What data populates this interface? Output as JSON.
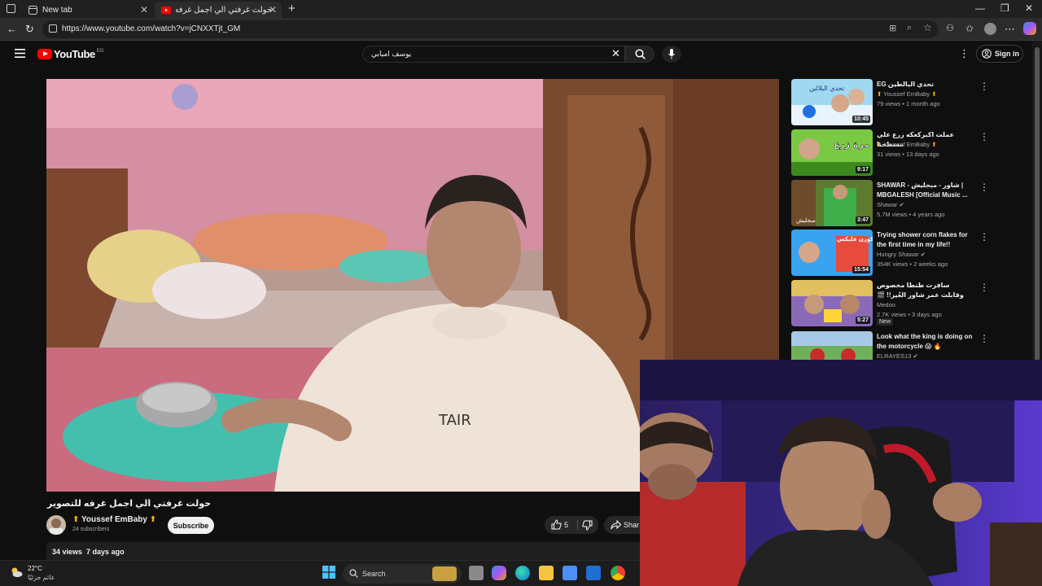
{
  "browser": {
    "tabs": [
      {
        "label": "New tab"
      },
      {
        "label": "حولت غرفتي الي اجمل غرفه للتصو"
      }
    ],
    "url": "https://www.youtube.com/watch?v=jCNXXTjt_GM"
  },
  "youtube": {
    "logo_text": "YouTube",
    "country_code": "EG",
    "search_query": "يوسف امبابي",
    "signin_label": "Sign in"
  },
  "video": {
    "title": "حولت غرفتي الي اجمل غرفه للتصوير",
    "channel": "Youssef EmBaby",
    "subscribers": "24 subscribers",
    "subscribe_label": "Subscribe",
    "likes": "5",
    "share_label": "Shar",
    "views": "34 views",
    "date": "7 days ago",
    "overlay_text": "TAIR"
  },
  "recommendations": [
    {
      "title": "تحدي البالطين EG",
      "channel": "Youssef EmBaby",
      "meta": "79 views • 1 month ago",
      "duration": "10:45",
      "thumb_text": "تحدي البلالين"
    },
    {
      "title": "عملت اكبركعكه زرع علي مسطحنا",
      "channel": "Youssef EmBaby",
      "meta": "31 views • 13 days ago",
      "duration": "9:17",
      "thumb_text": "تول مرة زرع"
    },
    {
      "title": "SHAWAR - شاور - مبجلیش | MBGALESH [Official Music ...",
      "channel": "Shawar",
      "meta": "5.7M views • 4 years ago",
      "duration": "3:47",
      "thumb_text": "مبجليش"
    },
    {
      "title": "Trying shower corn flakes for the first time in my life!!",
      "channel": "Hungry Shawar",
      "meta": "354K views • 2 weeks ago",
      "duration": "15:54",
      "thumb_text": "كورن فليكس"
    },
    {
      "title": "سافرت طنطا مخصوص وقابلت عمر شاور العُيز!! 🎬 (ما كنتش متخيل اللي حصل)",
      "channel": "Medoo",
      "meta": "2.7K views • 3 days ago",
      "duration": "5:27",
      "badge": "New"
    },
    {
      "title": "Look what the king is doing on the motorcycle 😱 🔥",
      "channel": "ELRAYES13",
      "meta": ""
    }
  ],
  "taskbar": {
    "temperature": "22°C",
    "weather_text": "غائم جزئيًا",
    "search_label": "Search"
  },
  "colors": {
    "brand_red": "#ff0000",
    "background": "#0f0f0f"
  }
}
